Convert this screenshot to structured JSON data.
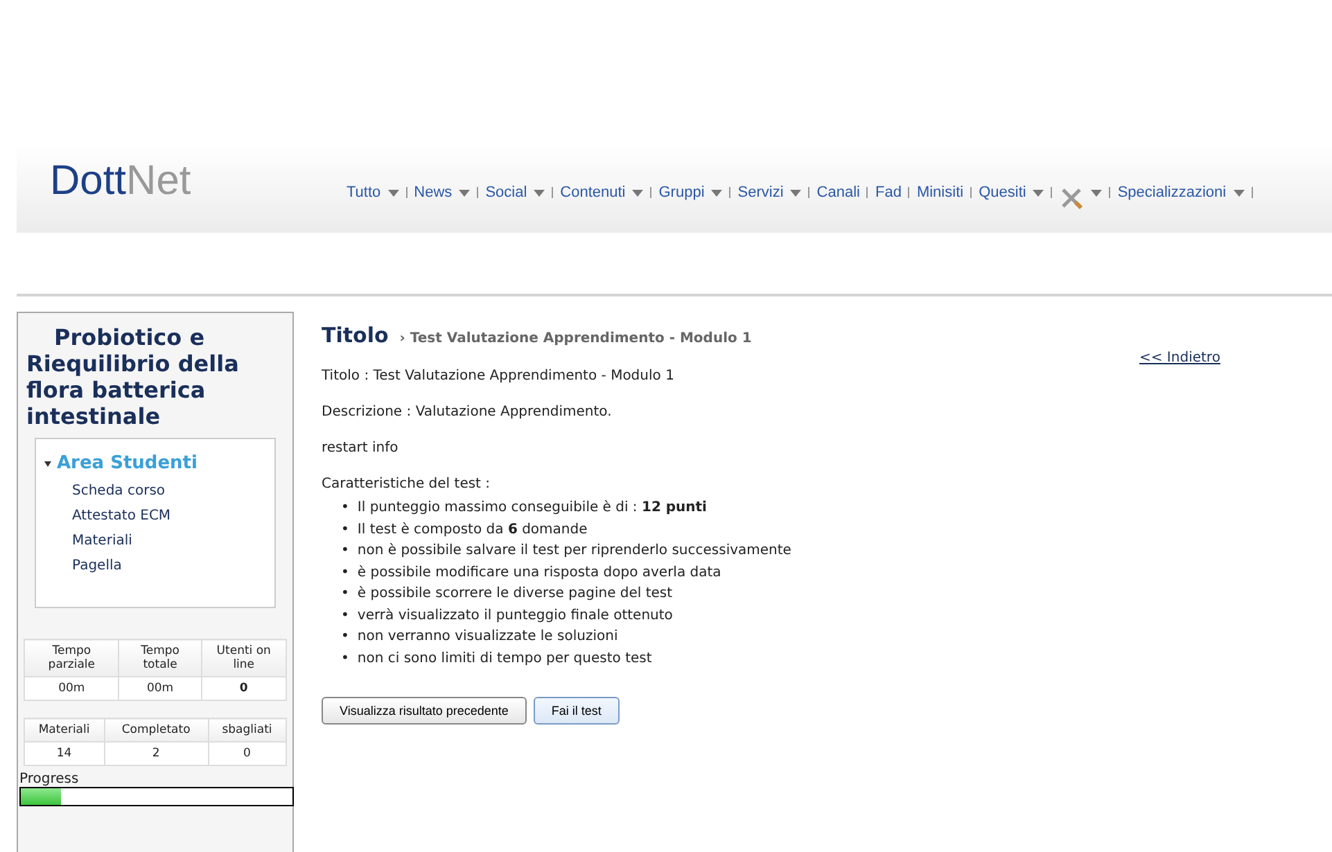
{
  "header": {
    "logo": {
      "part_1": "Dott",
      "part_2": "Net"
    },
    "nav": [
      {
        "kind": "text",
        "label": "Tutto",
        "has_menu": true
      },
      {
        "kind": "text",
        "label": "News",
        "has_menu": true
      },
      {
        "kind": "text",
        "label": "Social",
        "has_menu": true
      },
      {
        "kind": "text",
        "label": "Contenuti",
        "has_menu": true
      },
      {
        "kind": "text",
        "label": "Gruppi",
        "has_menu": true
      },
      {
        "kind": "text",
        "label": "Servizi",
        "has_menu": true
      },
      {
        "kind": "text",
        "label": "Canali",
        "has_menu": false
      },
      {
        "kind": "text",
        "label": "Fad",
        "has_menu": false
      },
      {
        "kind": "text",
        "label": "Minisiti",
        "has_menu": false
      },
      {
        "kind": "text",
        "label": "Quesiti",
        "has_menu": true
      },
      {
        "kind": "tools",
        "has_menu": true
      },
      {
        "kind": "text",
        "label": "Specializzazioni",
        "has_menu": true
      }
    ]
  },
  "sidebar": {
    "course_title": "Probiotico e Riequilibrio della flora batterica intestinale",
    "menu": {
      "title": "Area Studenti",
      "expanded": true,
      "items": [
        "Scheda corso",
        "Attestato ECM",
        "Materiali",
        "Pagella"
      ]
    },
    "stats_1": {
      "columns": [
        "Tempo parziale",
        "Tempo totale",
        "Utenti on line"
      ],
      "values": [
        "00m",
        "00m",
        "0"
      ]
    },
    "stats_2": {
      "columns": [
        "Materiali",
        "Completato",
        "sbagliati"
      ],
      "values": [
        "14",
        "2",
        "0"
      ]
    },
    "progress": {
      "label": "Progress",
      "level": 0.15
    }
  },
  "main": {
    "heading": "Titolo",
    "breadcrumb": "› Test Valutazione Apprendimento - Modulo 1",
    "back_link": "<< Indietro",
    "title_line": "Titolo : Test Valutazione Apprendimento - Modulo 1",
    "description": "Descrizione : Valutazione Apprendimento.",
    "restart_info": "restart info",
    "features_label": "Caratteristiche del test :",
    "features": [
      {
        "bullet": "•",
        "text": "Il punteggio massimo conseguibile è di : **12 punti**"
      },
      {
        "bullet": "•",
        "text": "Il test è composto da **6** domande"
      },
      {
        "bullet": "•",
        "text": "non è possibile salvare il test per riprenderlo successivamente"
      },
      {
        "bullet": "•",
        "text": "è possibile modificare una risposta dopo averla data"
      },
      {
        "bullet": "•",
        "text": "è possibile scorrere le diverse pagine del test"
      },
      {
        "bullet": "•",
        "text": "verrà visualizzato il punteggio finale ottenuto"
      },
      {
        "bullet": "•",
        "text": "non verranno visualizzate le soluzioni"
      },
      {
        "bullet": "•",
        "text": "non ci sono limiti di tempo per questo test"
      }
    ],
    "buttons": [
      {
        "label": "Visualizza risultato precedente",
        "primary": false
      },
      {
        "label": "Fai il test",
        "primary": true
      }
    ]
  }
}
